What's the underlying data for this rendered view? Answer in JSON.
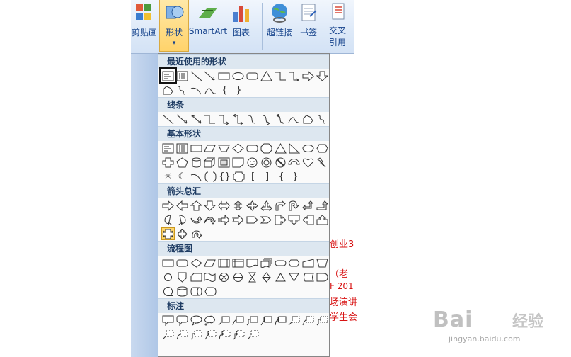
{
  "ribbon": {
    "paste": "剪贴画",
    "shapes": "形状",
    "shapes_arrow": "▾",
    "smartart": "SmartArt",
    "chart": "图表",
    "hyperlink": "超链接",
    "bookmark": "书签",
    "crossref_line1": "交叉",
    "crossref_line2": "引用"
  },
  "menu": {
    "sections": [
      {
        "title": "最近使用的形状"
      },
      {
        "title": "线条"
      },
      {
        "title": "基本形状"
      },
      {
        "title": "箭头总汇"
      },
      {
        "title": "流程图"
      },
      {
        "title": "标注"
      }
    ]
  },
  "document_text": [
    "创业3",
    "（老",
    "F 201",
    "场演讲",
    "学生会"
  ],
  "watermark": {
    "logo": "Bai",
    "logo2": "经验",
    "url": "jingyan.baidu.com"
  },
  "colors": {
    "ribbon_text": "#15428b",
    "doc_text": "#d81313",
    "section_header_bg": "#dde7f0"
  }
}
